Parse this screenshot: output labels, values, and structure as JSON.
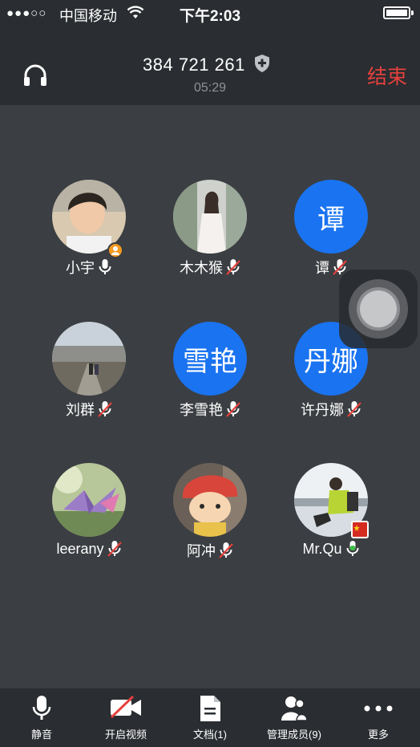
{
  "status_bar": {
    "signal": "●●●○○",
    "carrier": "中国移动",
    "time": "下午2:03"
  },
  "header": {
    "meeting_id": "384 721 261",
    "duration": "05:29",
    "end_label": "结束",
    "end_color": "#e5413c"
  },
  "participants": [
    {
      "name": "小宇",
      "avatar_type": "photo",
      "mic": "on",
      "badge": "host"
    },
    {
      "name": "木木猴",
      "avatar_type": "photo",
      "mic": "muted"
    },
    {
      "name": "谭",
      "avatar_type": "text",
      "avatar_text": "谭",
      "mic": "muted"
    },
    {
      "name": "刘群",
      "avatar_type": "photo",
      "mic": "muted"
    },
    {
      "name": "李雪艳",
      "avatar_type": "text",
      "avatar_text": "雪艳",
      "mic": "muted"
    },
    {
      "name": "许丹娜",
      "avatar_type": "text",
      "avatar_text": "丹娜",
      "mic": "muted"
    },
    {
      "name": "leerany",
      "avatar_type": "photo",
      "mic": "muted"
    },
    {
      "name": "阿冲",
      "avatar_type": "photo",
      "mic": "muted"
    },
    {
      "name": "Mr.Qu",
      "avatar_type": "photo",
      "mic": "speaking"
    }
  ],
  "toolbar": {
    "mute_label": "静音",
    "video_label": "开启视频",
    "docs_label": "文档(1)",
    "members_label": "管理成员(9)",
    "more_label": "更多"
  },
  "colors": {
    "avatar_blue": "#1a73f0",
    "muted_red": "#e5413c",
    "speaking_green": "#3ec14a"
  }
}
